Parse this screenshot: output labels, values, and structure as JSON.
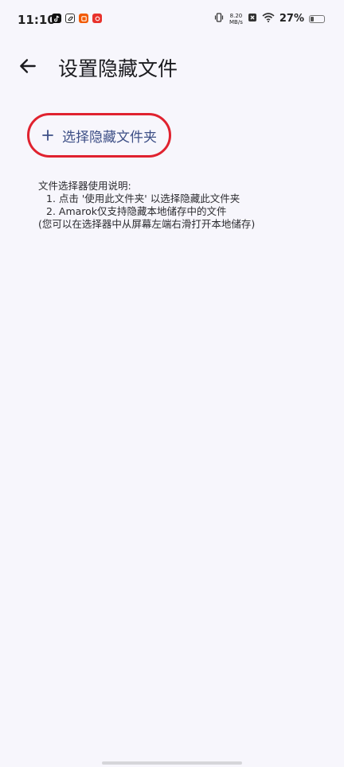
{
  "status_bar": {
    "time": "11:10",
    "net_speed_value": "8.20",
    "net_speed_unit": "MB/s",
    "battery_percent": "27%",
    "battery_level": 0.27,
    "notification_icons": [
      "tiktok-icon",
      "app-swirl-icon",
      "taobao-icon",
      "red-app-icon"
    ]
  },
  "app_bar": {
    "title": "设置隐藏文件",
    "back_icon": "arrow-left-icon"
  },
  "main": {
    "select_button": {
      "icon": "plus-icon",
      "label": "选择隐藏文件夹"
    },
    "instructions": {
      "heading": "文件选择器使用说明:",
      "step_1": "1. 点击 '使用此文件夹' 以选择隐藏此文件夹",
      "step_2": "2. Amarok仅支持隐藏本地储存中的文件",
      "note": "(您可以在选择器中从屏幕左端右滑打开本地储存)"
    }
  },
  "colors": {
    "background": "#f7f6fc",
    "accent": "#3d4f86",
    "highlight_ring": "#e0222f"
  }
}
